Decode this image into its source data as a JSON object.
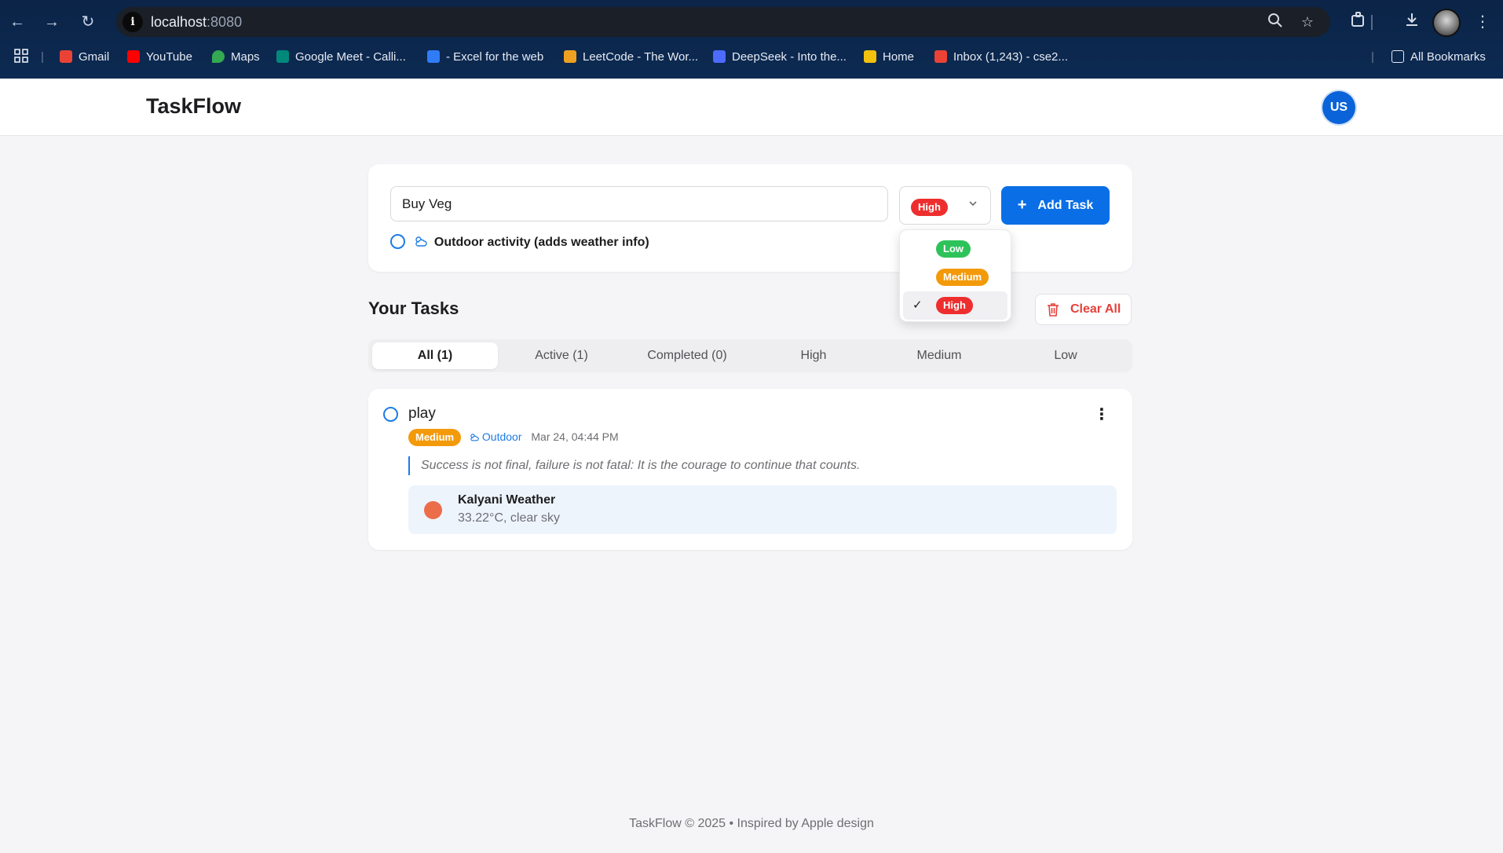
{
  "browser": {
    "url_host": "localhost",
    "url_port": ":8080",
    "bookmarks": [
      {
        "label": "Gmail",
        "color": "#ea4335"
      },
      {
        "label": "YouTube",
        "color": "#ff0000"
      },
      {
        "label": "Maps",
        "color": "#34a853"
      },
      {
        "label": "Google Meet - Calli...",
        "color": "#00897b"
      },
      {
        "label": "- Excel for the web",
        "color": "#2f7cf6"
      },
      {
        "label": "LeetCode - The Wor...",
        "color": "#f0a020"
      },
      {
        "label": "DeepSeek - Into the...",
        "color": "#4d6bfe"
      },
      {
        "label": "Home",
        "color": "#f4c20d"
      },
      {
        "label": "Inbox (1,243) - cse2...",
        "color": "#ea4335"
      }
    ],
    "all_bookmarks": "All Bookmarks"
  },
  "header": {
    "brand": "TaskFlow",
    "avatar_initials": "US"
  },
  "add_form": {
    "input_value": "Buy Veg",
    "selected_priority": "High",
    "add_button": "Add Task",
    "outdoor_label": "Outdoor activity (adds weather info)",
    "dropdown_options": [
      {
        "label": "Low",
        "selected": false
      },
      {
        "label": "Medium",
        "selected": false
      },
      {
        "label": "High",
        "selected": true
      }
    ]
  },
  "tasks_section": {
    "title": "Your Tasks",
    "clear_all": "Clear All",
    "tabs": [
      "All (1)",
      "Active (1)",
      "Completed (0)",
      "High",
      "Medium",
      "Low"
    ],
    "active_tab": 0
  },
  "tasks": [
    {
      "title": "play",
      "priority": "Medium",
      "outdoor_tag": "Outdoor",
      "date": "Mar 24, 04:44 PM",
      "quote": "Success is not final, failure is not fatal: It is the courage to continue that counts.",
      "weather_title": "Kalyani Weather",
      "weather_desc": "33.22°C, clear sky"
    }
  ],
  "footer": "TaskFlow © 2025 • Inspired by Apple design",
  "colors": {
    "accent": "#0a6fe6",
    "high": "#ee2e2e",
    "medium": "#f39a0b",
    "low": "#2ec35a",
    "danger": "#e5413a"
  }
}
